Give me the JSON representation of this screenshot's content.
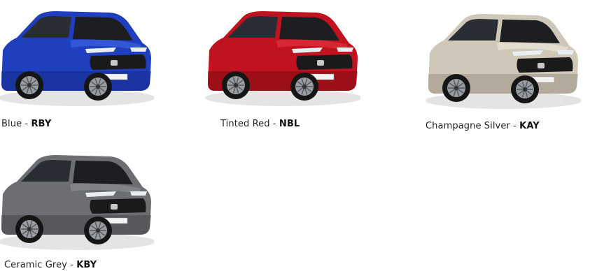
{
  "palette": {
    "title": "",
    "colours": [
      {
        "name": "Blue",
        "separator": " - ",
        "code": "RBY",
        "body_color": "#1f3fbf",
        "body_shade": "#142a86",
        "body_light": "#3a62e0"
      },
      {
        "name": "Tinted Red",
        "separator": " - ",
        "code": "NBL",
        "body_color": "#c0121f",
        "body_shade": "#7e0b13",
        "body_light": "#e2303a"
      },
      {
        "name": "Champagne Silver",
        "separator": " - ",
        "code": "KAY",
        "body_color": "#cfc8b8",
        "body_shade": "#9b9483",
        "body_light": "#ece6d8"
      },
      {
        "name": "Ceramic Grey",
        "separator": " - ",
        "code": "KBY",
        "body_color": "#6c6e72",
        "body_shade": "#45474b",
        "body_light": "#8a8c90"
      }
    ]
  }
}
